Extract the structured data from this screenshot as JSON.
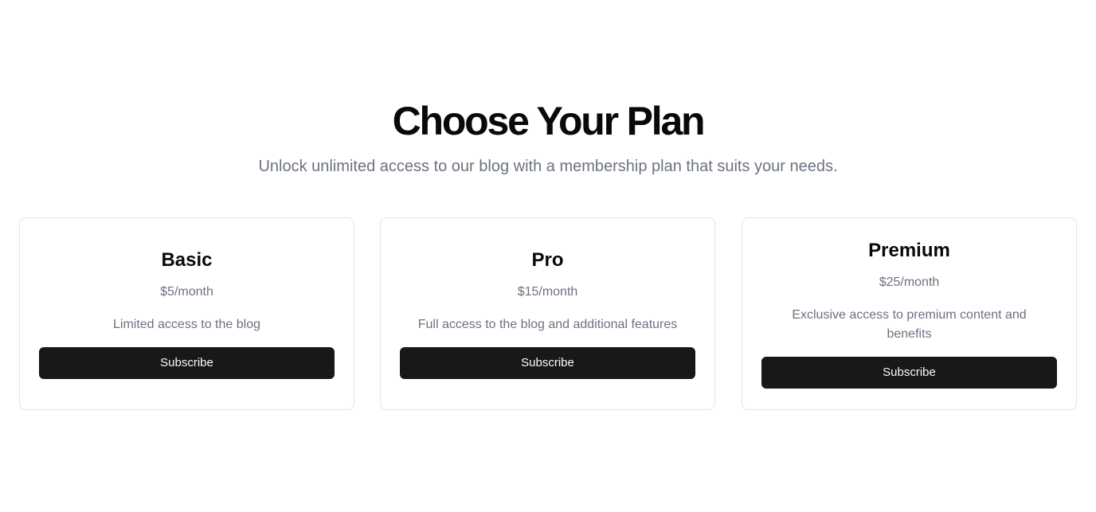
{
  "header": {
    "title": "Choose Your Plan",
    "subtitle": "Unlock unlimited access to our blog with a membership plan that suits your needs."
  },
  "plans": [
    {
      "name": "Basic",
      "price": "$5/month",
      "description": "Limited access to the blog",
      "button_label": "Subscribe"
    },
    {
      "name": "Pro",
      "price": "$15/month",
      "description": "Full access to the blog and additional features",
      "button_label": "Subscribe"
    },
    {
      "name": "Premium",
      "price": "$25/month",
      "description": "Exclusive access to premium content and benefits",
      "button_label": "Subscribe"
    }
  ],
  "colors": {
    "button_background": "#18181b",
    "button_text": "#fafafa",
    "muted_text": "#6b7280",
    "card_border": "#e4e4e7",
    "heading_text": "#09090b"
  }
}
